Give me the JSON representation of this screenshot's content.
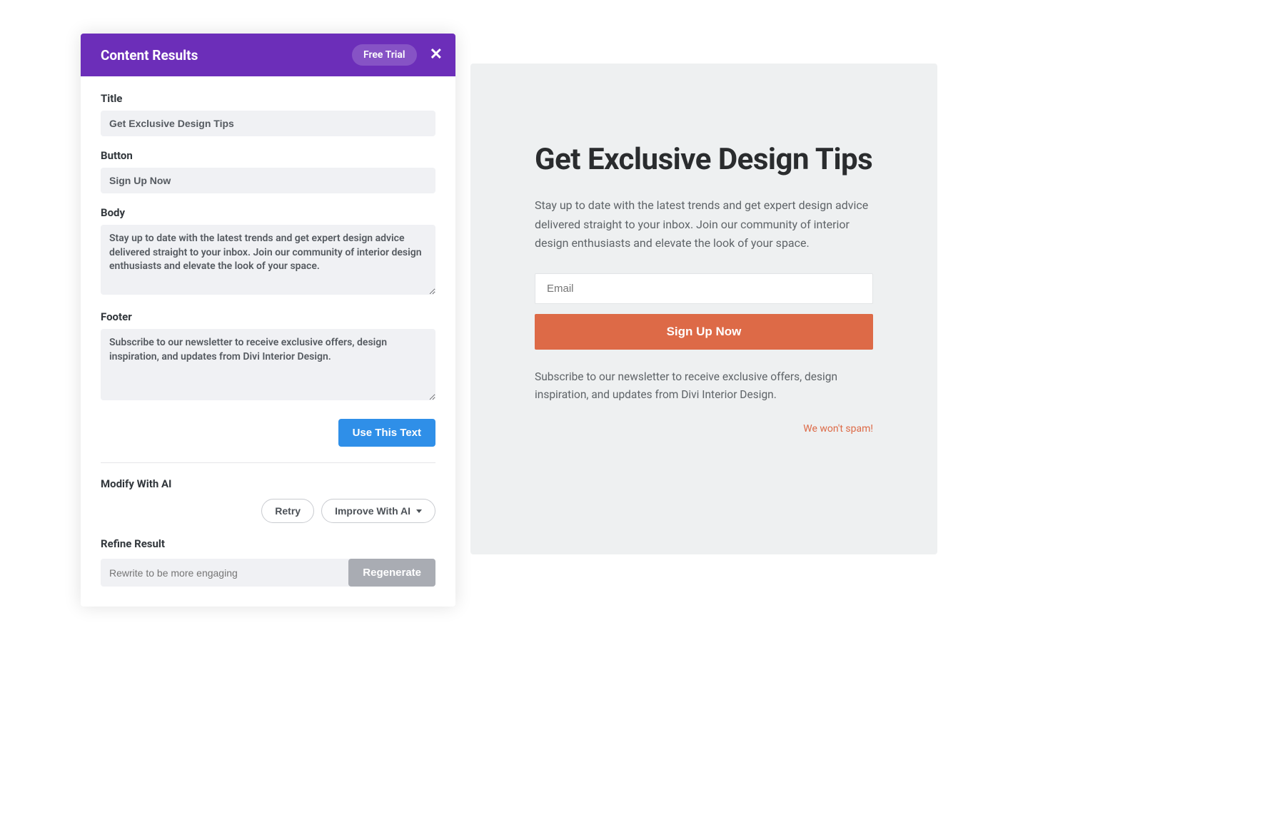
{
  "panel": {
    "header": {
      "title": "Content Results",
      "trial": "Free Trial",
      "close": "✕"
    },
    "fields": {
      "title_label": "Title",
      "title_value": "Get Exclusive Design Tips",
      "button_label": "Button",
      "button_value": "Sign Up Now",
      "body_label": "Body",
      "body_value": "Stay up to date with the latest trends and get expert design advice delivered straight to your inbox. Join our community of interior design enthusiasts and elevate the look of your space.",
      "footer_label": "Footer",
      "footer_value": "Subscribe to our newsletter to receive exclusive offers, design inspiration, and updates from Divi Interior Design."
    },
    "actions": {
      "use_text": "Use This Text",
      "modify_label": "Modify With AI",
      "retry": "Retry",
      "improve": "Improve With AI",
      "refine_label": "Refine Result",
      "refine_placeholder": "Rewrite to be more engaging",
      "regenerate": "Regenerate"
    }
  },
  "preview": {
    "title": "Get Exclusive Design Tips",
    "body": "Stay up to date with the latest trends and get expert design advice delivered straight to your inbox. Join our community of interior design enthusiasts and elevate the look of your space.",
    "email_placeholder": "Email",
    "cta": "Sign Up Now",
    "footer": "Subscribe to our newsletter to receive exclusive offers, design inspiration, and updates from Divi Interior Design.",
    "nospam": "We won't spam!"
  }
}
